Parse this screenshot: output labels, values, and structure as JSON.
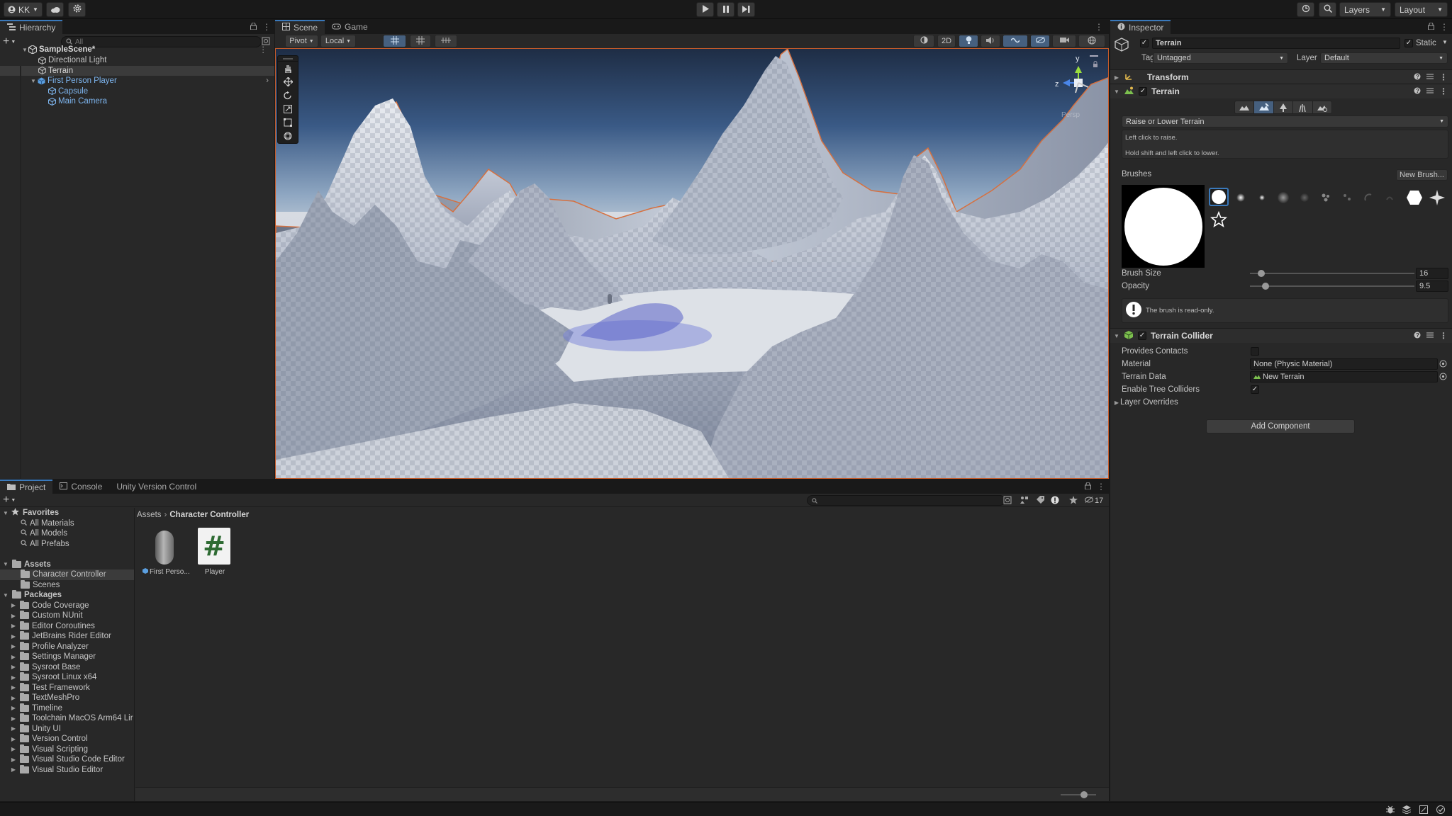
{
  "toolbar": {
    "account": "KK",
    "layers": "Layers",
    "layout": "Layout"
  },
  "hierarchy": {
    "tab": "Hierarchy",
    "search_placeholder": "All",
    "items": [
      {
        "label": "SampleScene*"
      },
      {
        "label": "Directional Light"
      },
      {
        "label": "Terrain"
      },
      {
        "label": "First Person Player"
      },
      {
        "label": "Capsule"
      },
      {
        "label": "Main Camera"
      }
    ]
  },
  "scene": {
    "tabs": [
      "Scene",
      "Game"
    ],
    "pivot": "Pivot",
    "local": "Local",
    "mode_2d": "2D",
    "gizmo_axis_y": "y",
    "gizmo_axis_z": "z",
    "gizmo_label": "Persp"
  },
  "inspector": {
    "tab": "Inspector",
    "object_name": "Terrain",
    "static_label": "Static",
    "tag_label": "Tag",
    "tag_value": "Untagged",
    "layer_label": "Layer",
    "layer_value": "Default",
    "transform": "Transform",
    "terrain": "Terrain",
    "tool_dropdown": "Raise or Lower Terrain",
    "help_line1": "Left click to raise.",
    "help_line2": "Hold shift and left click to lower.",
    "brushes_label": "Brushes",
    "new_brush": "New Brush...",
    "brush_size_label": "Brush Size",
    "brush_size_value": "16",
    "brush_size": 0.07,
    "opacity_label": "Opacity",
    "opacity_value": "9.5",
    "opacity": 0.095,
    "readonly_msg": "The brush is read-only.",
    "collider": "Terrain Collider",
    "provides_contacts": "Provides Contacts",
    "material_label": "Material",
    "material_value": "None (Physic Material)",
    "terrain_data_label": "Terrain Data",
    "terrain_data_value": "New Terrain",
    "enable_tree": "Enable Tree Colliders",
    "layer_overrides": "Layer Overrides",
    "add_component": "Add Component"
  },
  "project": {
    "tabs": [
      "Project",
      "Console",
      "Unity Version Control"
    ],
    "badge": "17",
    "favorites_label": "Favorites",
    "favorites": [
      "All Materials",
      "All Models",
      "All Prefabs"
    ],
    "assets_label": "Assets",
    "assets": [
      "Character Controller",
      "Scenes"
    ],
    "packages_label": "Packages",
    "packages": [
      "Code Coverage",
      "Custom NUnit",
      "Editor Coroutines",
      "JetBrains Rider Editor",
      "Profile Analyzer",
      "Settings Manager",
      "Sysroot Base",
      "Sysroot Linux x64",
      "Test Framework",
      "TextMeshPro",
      "Timeline",
      "Toolchain MacOS Arm64 Lir",
      "Unity UI",
      "Version Control",
      "Visual Scripting",
      "Visual Studio Code Editor",
      "Visual Studio Editor"
    ],
    "breadcrumb": [
      "Assets",
      "Character Controller"
    ],
    "files": [
      {
        "label": "First Perso..."
      },
      {
        "label": "Player",
        "glyph": "#"
      }
    ]
  }
}
